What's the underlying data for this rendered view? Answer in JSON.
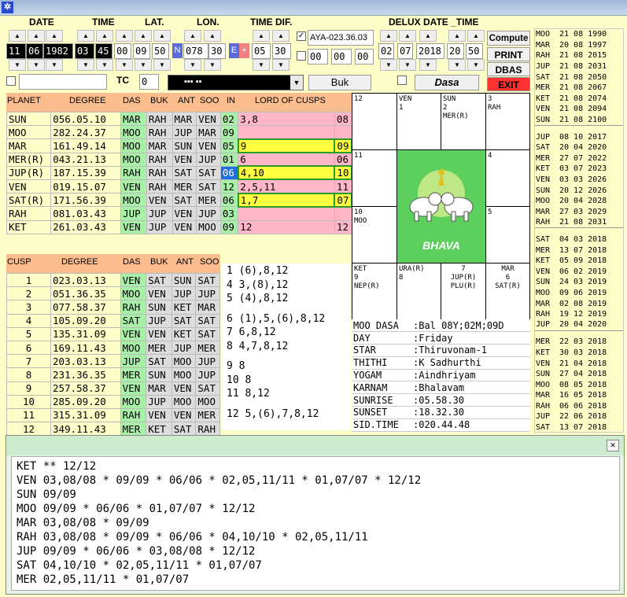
{
  "titlebar_icon": "✲",
  "headers": {
    "date": "DATE",
    "time": "TIME",
    "lat": "LAT.",
    "lon": "LON.",
    "timedif": "TIME DIF.",
    "delux": "DELUX DATE _TIME"
  },
  "inputs": {
    "day": "11",
    "month": "06",
    "year": "1982",
    "hour": "03",
    "min": "45",
    "sec": "00",
    "lat_deg": "09",
    "lat_min": "50",
    "lat_dir": "N",
    "lon_deg": "078",
    "lon_min": "30",
    "tz_dir": "E",
    "tz_sign": "+",
    "tz_h": "05",
    "tz_m": "30",
    "aya": "AYA-023.36.03",
    "aya2_a": "00",
    "aya2_b": "00",
    "aya2_c": "00",
    "dx_d": "02",
    "dx_m": "07",
    "dx_y": "2018",
    "dx_h": "20",
    "dx_min": "50",
    "tc_label": "TC",
    "tc": "0",
    "lang": "▪▪▪ ▪▪"
  },
  "buttons": {
    "compute": "Compute",
    "print": "PRINT",
    "dbas": "DBAS",
    "exit": "EXIT",
    "buk": "Buk",
    "dasa": "Dasa"
  },
  "planet_headers": [
    "PLANET",
    "DEGREE",
    "DAS",
    "BUK",
    "ANT",
    "SOO",
    "IN",
    "LORD OF CUSPS"
  ],
  "planets": [
    [
      "SUN",
      "056.05.10",
      "MAR",
      "RAH",
      "MAR",
      "VEN",
      "02",
      "3,8",
      "08"
    ],
    [
      "MOO",
      "282.24.37",
      "MOO",
      "RAH",
      "JUP",
      "MAR",
      "09",
      "",
      ""
    ],
    [
      "MAR",
      "161.49.14",
      "MOO",
      "MAR",
      "SUN",
      "VEN",
      "05",
      "9",
      "09"
    ],
    [
      "MER(R)",
      "043.21.13",
      "MOO",
      "RAH",
      "VEN",
      "JUP",
      "01",
      "6",
      "06"
    ],
    [
      "JUP(R)",
      "187.15.39",
      "RAH",
      "RAH",
      "SAT",
      "SAT",
      "06",
      "4,10",
      "10"
    ],
    [
      "VEN",
      "019.15.07",
      "VEN",
      "RAH",
      "MER",
      "SAT",
      "12",
      "2,5,11",
      "11"
    ],
    [
      "SAT(R)",
      "171.56.39",
      "MOO",
      "VEN",
      "SAT",
      "MER",
      "06",
      "1,7",
      "07"
    ],
    [
      "RAH",
      "081.03.43",
      "JUP",
      "JUP",
      "VEN",
      "JUP",
      "03",
      "",
      ""
    ],
    [
      "KET",
      "261.03.43",
      "VEN",
      "JUP",
      "VEN",
      "MOO",
      "09",
      "12",
      "12"
    ]
  ],
  "cusp_headers": [
    "CUSP",
    "DEGREE",
    "DAS",
    "BUK",
    "ANT",
    "SOO"
  ],
  "cusps": [
    [
      "1",
      "023.03.13",
      "VEN",
      "SAT",
      "SUN",
      "SAT"
    ],
    [
      "2",
      "051.36.35",
      "MOO",
      "VEN",
      "JUP",
      "JUP"
    ],
    [
      "3",
      "077.58.37",
      "RAH",
      "SUN",
      "KET",
      "MAR"
    ],
    [
      "4",
      "105.09.20",
      "SAT",
      "JUP",
      "SAT",
      "SAT"
    ],
    [
      "5",
      "135.31.09",
      "VEN",
      "VEN",
      "KET",
      "SAT"
    ],
    [
      "6",
      "169.11.43",
      "MOO",
      "MER",
      "JUP",
      "MER"
    ],
    [
      "7",
      "203.03.13",
      "JUP",
      "SAT",
      "MOO",
      "JUP"
    ],
    [
      "8",
      "231.36.35",
      "MER",
      "SUN",
      "MOO",
      "JUP"
    ],
    [
      "9",
      "257.58.37",
      "VEN",
      "MAR",
      "VEN",
      "SAT"
    ],
    [
      "10",
      "285.09.20",
      "MOO",
      "JUP",
      "MOO",
      "MOO"
    ],
    [
      "11",
      "315.31.09",
      "RAH",
      "VEN",
      "VEN",
      "MER"
    ],
    [
      "12",
      "349.11.43",
      "MER",
      "KET",
      "SAT",
      "RAH"
    ]
  ],
  "cusp_sig": [
    "1 (6),8,12",
    "4 3,(8),12",
    "5 (4),8,12",
    "",
    "6 (1),5,(6),8,12",
    "7 6,8,12",
    "8 4,7,8,12",
    "",
    "9 8",
    "10 8",
    "11 8,12",
    "",
    "12 5,(6),7,8,12"
  ],
  "chart": {
    "c12": "12",
    "c1": "VEN\n1",
    "c2": "SUN\n2\nMER(R)",
    "c3": "3\nRAH",
    "c11": "11",
    "c4": "4",
    "c10": "10\nMOO",
    "c5": "5",
    "c9": "KET\n9\nNEP(R)",
    "c8": "URA(R)\n8",
    "c7": "7\nJUP(R)\nPLU(R)",
    "c6": "MAR\n6\nSAT(R)",
    "center": "BHAVA"
  },
  "info": [
    [
      "MOO DASA",
      ":Bal 08Y;02M;09D"
    ],
    [
      "DAY",
      ":Friday"
    ],
    [
      "STAR",
      ":Thiruvonam-1"
    ],
    [
      "THITHI",
      ":K Sadhurthi"
    ],
    [
      "YOGAM",
      ":Aindhriyam"
    ],
    [
      "KARNAM",
      ":Bhalavam"
    ],
    [
      "SUNRISE",
      ":05.58.30"
    ],
    [
      "SUNSET",
      ":18.32.30"
    ],
    [
      "SID.TIME",
      ":020.44.48"
    ]
  ],
  "dasa": [
    [
      "MOO",
      "21 08 1990"
    ],
    [
      "MAR",
      "20 08 1997"
    ],
    [
      "RAH",
      "21 08 2015"
    ],
    [
      "JUP",
      "21 08 2031"
    ],
    [
      "SAT",
      "21 08 2050"
    ],
    [
      "MER",
      "21 08 2067"
    ],
    [
      "KET",
      "21 08 2074"
    ],
    [
      "VEN",
      "21 08 2094"
    ],
    [
      "SUN",
      "21 08 2100"
    ],
    [
      "JUP",
      "08 10 2017"
    ],
    [
      "SAT",
      "20 04 2020"
    ],
    [
      "MER",
      "27 07 2022"
    ],
    [
      "KET",
      "03 07 2023"
    ],
    [
      "VEN",
      "03 03 2026"
    ],
    [
      "SUN",
      "20 12 2026"
    ],
    [
      "MOO",
      "20 04 2028"
    ],
    [
      "MAR",
      "27 03 2029"
    ],
    [
      "RAH",
      "21 08 2031"
    ],
    [
      "SAT",
      "04 03 2018"
    ],
    [
      "MER",
      "13 07 2018"
    ],
    [
      "KET",
      "05 09 2018"
    ],
    [
      "VEN",
      "06 02 2019"
    ],
    [
      "SUN",
      "24 03 2019"
    ],
    [
      "MOO",
      "09 06 2019"
    ],
    [
      "MAR",
      "02 08 2019"
    ],
    [
      "RAH",
      "19 12 2019"
    ],
    [
      "JUP",
      "20 04 2020"
    ],
    [
      "MER",
      "22 03 2018"
    ],
    [
      "KET",
      "30 03 2018"
    ],
    [
      "VEN",
      "21 04 2018"
    ],
    [
      "SUN",
      "27 04 2018"
    ],
    [
      "MOO",
      "08 05 2018"
    ],
    [
      "MAR",
      "16 05 2018"
    ],
    [
      "RAH",
      "06 06 2018"
    ],
    [
      "JUP",
      "22 06 2018"
    ],
    [
      "SAT",
      "13 07 2018"
    ]
  ],
  "bottom_text": "KET ** 12/12\nVEN 03,08/08 * 09/09 * 06/06 * 02,05,11/11 * 01,07/07 * 12/12\nSUN 09/09\nMOO 09/09 * 06/06 * 01,07/07 * 12/12\nMAR 03,08/08 * 09/09\nRAH 03,08/08 * 09/09 * 06/06 * 04,10/10 * 02,05,11/11\nJUP 09/09 * 06/06 * 03,08/08 * 12/12\nSAT 04,10/10 * 02,05,11/11 * 01,07/07\nMER 02,05,11/11 * 01,07/07",
  "close_glyph": "✕"
}
